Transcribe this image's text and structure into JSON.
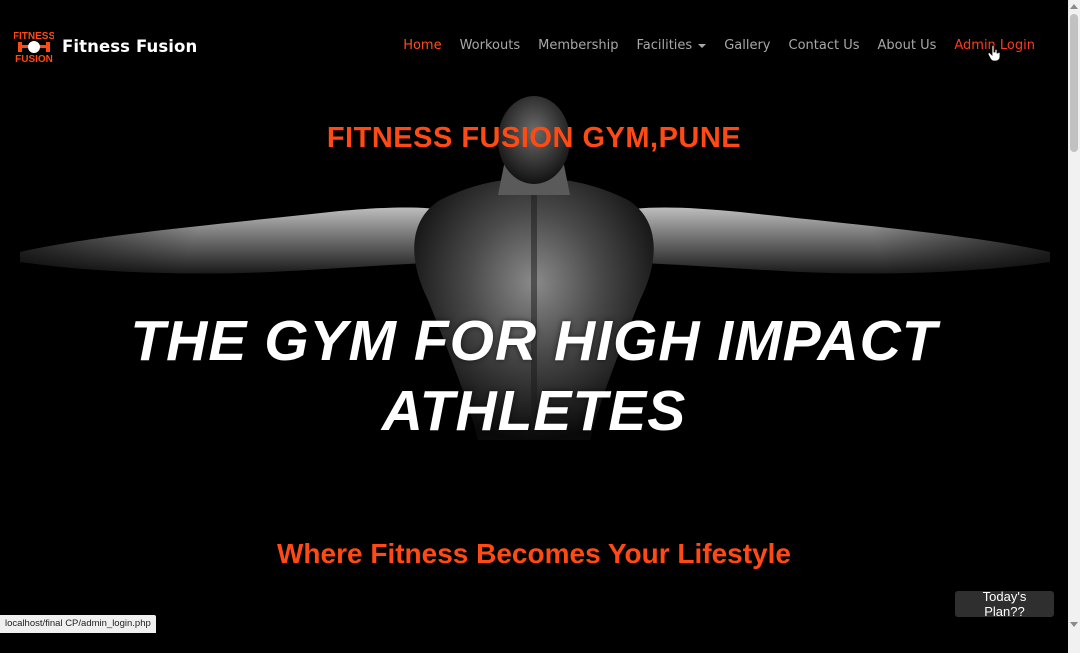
{
  "brand": {
    "name": "Fitness Fusion",
    "logo_text_top": "FITNESS",
    "logo_text_bottom": "FUSION"
  },
  "nav": {
    "items": [
      {
        "label": "Home",
        "state": "active"
      },
      {
        "label": "Workouts",
        "state": ""
      },
      {
        "label": "Membership",
        "state": ""
      },
      {
        "label": "Facilities",
        "state": "dropdown"
      },
      {
        "label": "Gallery",
        "state": ""
      },
      {
        "label": "Contact Us",
        "state": ""
      },
      {
        "label": "About Us",
        "state": ""
      },
      {
        "label": "Admin Login",
        "state": "hover"
      }
    ]
  },
  "hero": {
    "gym_title": "FITNESS FUSION GYM,PUNE",
    "tagline_line1": "THE GYM FOR HIGH IMPACT",
    "tagline_line2": "ATHLETES",
    "lifestyle": "Where Fitness Becomes Your Lifestyle"
  },
  "floating_button": {
    "label": "Today's Plan??"
  },
  "status_bar": {
    "url": "localhost/final CP/admin_login.php"
  },
  "colors": {
    "accent": "#ff4a14",
    "nav_text": "#a8a8a8",
    "background": "#000000",
    "button_bg": "#2f2f2f"
  }
}
